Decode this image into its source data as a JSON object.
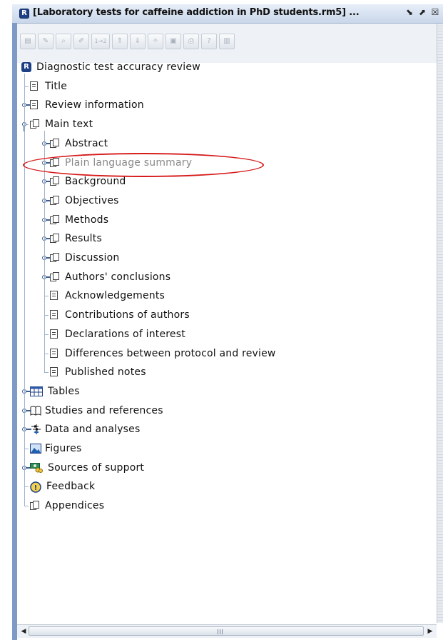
{
  "window": {
    "title": "[Laboratory tests for caffeine addiction in PhD students.rm5] ...",
    "app_icon_letter": "R",
    "minimize_glyph": "⬊",
    "maximize_glyph": "⬈",
    "close_glyph": "☒"
  },
  "toolbar": {
    "tools": [
      {
        "name": "new-item-icon",
        "glyph": "▤"
      },
      {
        "name": "edit-icon",
        "glyph": "✎"
      },
      {
        "name": "find-icon",
        "glyph": "⌕"
      },
      {
        "name": "properties-icon",
        "glyph": "✐"
      },
      {
        "name": "renumber-icon",
        "glyph": "1→2"
      },
      {
        "name": "move-up-icon",
        "glyph": "⇑"
      },
      {
        "name": "move-down-icon",
        "glyph": "⇓"
      },
      {
        "name": "wizard-icon",
        "glyph": "✧"
      },
      {
        "name": "add-icon",
        "glyph": "▣"
      },
      {
        "name": "print-icon",
        "glyph": "⎙"
      },
      {
        "name": "help-icon",
        "glyph": "?"
      },
      {
        "name": "pages-icon",
        "glyph": "▥"
      }
    ]
  },
  "tree": {
    "root": {
      "label": "Diagnostic test accuracy review",
      "icon": "review-manager-icon"
    },
    "items": [
      {
        "label": "Title",
        "icon": "document-icon",
        "indent": 1
      },
      {
        "label": "Review information",
        "icon": "document-icon",
        "indent": 1,
        "expandable": true
      },
      {
        "label": "Main text",
        "icon": "documents-icon",
        "indent": 1,
        "expandable": true,
        "open": true
      },
      {
        "label": "Abstract",
        "icon": "documents-icon",
        "indent": 2,
        "expandable": true
      },
      {
        "label": "Plain language summary",
        "icon": "documents-icon",
        "indent": 2,
        "expandable": true,
        "greyed": true
      },
      {
        "label": "Background",
        "icon": "documents-icon",
        "indent": 2,
        "expandable": true
      },
      {
        "label": "Objectives",
        "icon": "documents-icon",
        "indent": 2,
        "expandable": true
      },
      {
        "label": "Methods",
        "icon": "documents-icon",
        "indent": 2,
        "expandable": true
      },
      {
        "label": "Results",
        "icon": "documents-icon",
        "indent": 2,
        "expandable": true
      },
      {
        "label": "Discussion",
        "icon": "documents-icon",
        "indent": 2,
        "expandable": true
      },
      {
        "label": "Authors' conclusions",
        "icon": "documents-icon",
        "indent": 2,
        "expandable": true
      },
      {
        "label": "Acknowledgements",
        "icon": "document-icon",
        "indent": 2
      },
      {
        "label": "Contributions of authors",
        "icon": "document-icon",
        "indent": 2
      },
      {
        "label": "Declarations of interest",
        "icon": "document-icon",
        "indent": 2
      },
      {
        "label": "Differences between protocol and review",
        "icon": "document-icon",
        "indent": 2
      },
      {
        "label": "Published notes",
        "icon": "document-icon",
        "indent": 2
      },
      {
        "label": "Tables",
        "icon": "table-icon",
        "indent": 1,
        "expandable": true
      },
      {
        "label": "Studies and references",
        "icon": "book-icon",
        "indent": 1,
        "expandable": true
      },
      {
        "label": "Data and analyses",
        "icon": "forest-plot-icon",
        "indent": 1,
        "expandable": true
      },
      {
        "label": "Figures",
        "icon": "image-icon",
        "indent": 1
      },
      {
        "label": "Sources of support",
        "icon": "money-icon",
        "indent": 1,
        "expandable": true
      },
      {
        "label": "Feedback",
        "icon": "feedback-icon",
        "indent": 1
      },
      {
        "label": "Appendices",
        "icon": "documents-icon",
        "indent": 1
      }
    ]
  },
  "annotation": {
    "color": "#d61a1a",
    "highlights": "Plain language summary"
  },
  "scrollbar": {
    "left_glyph": "◀",
    "right_glyph": "▶",
    "grip_glyph": "|||"
  }
}
